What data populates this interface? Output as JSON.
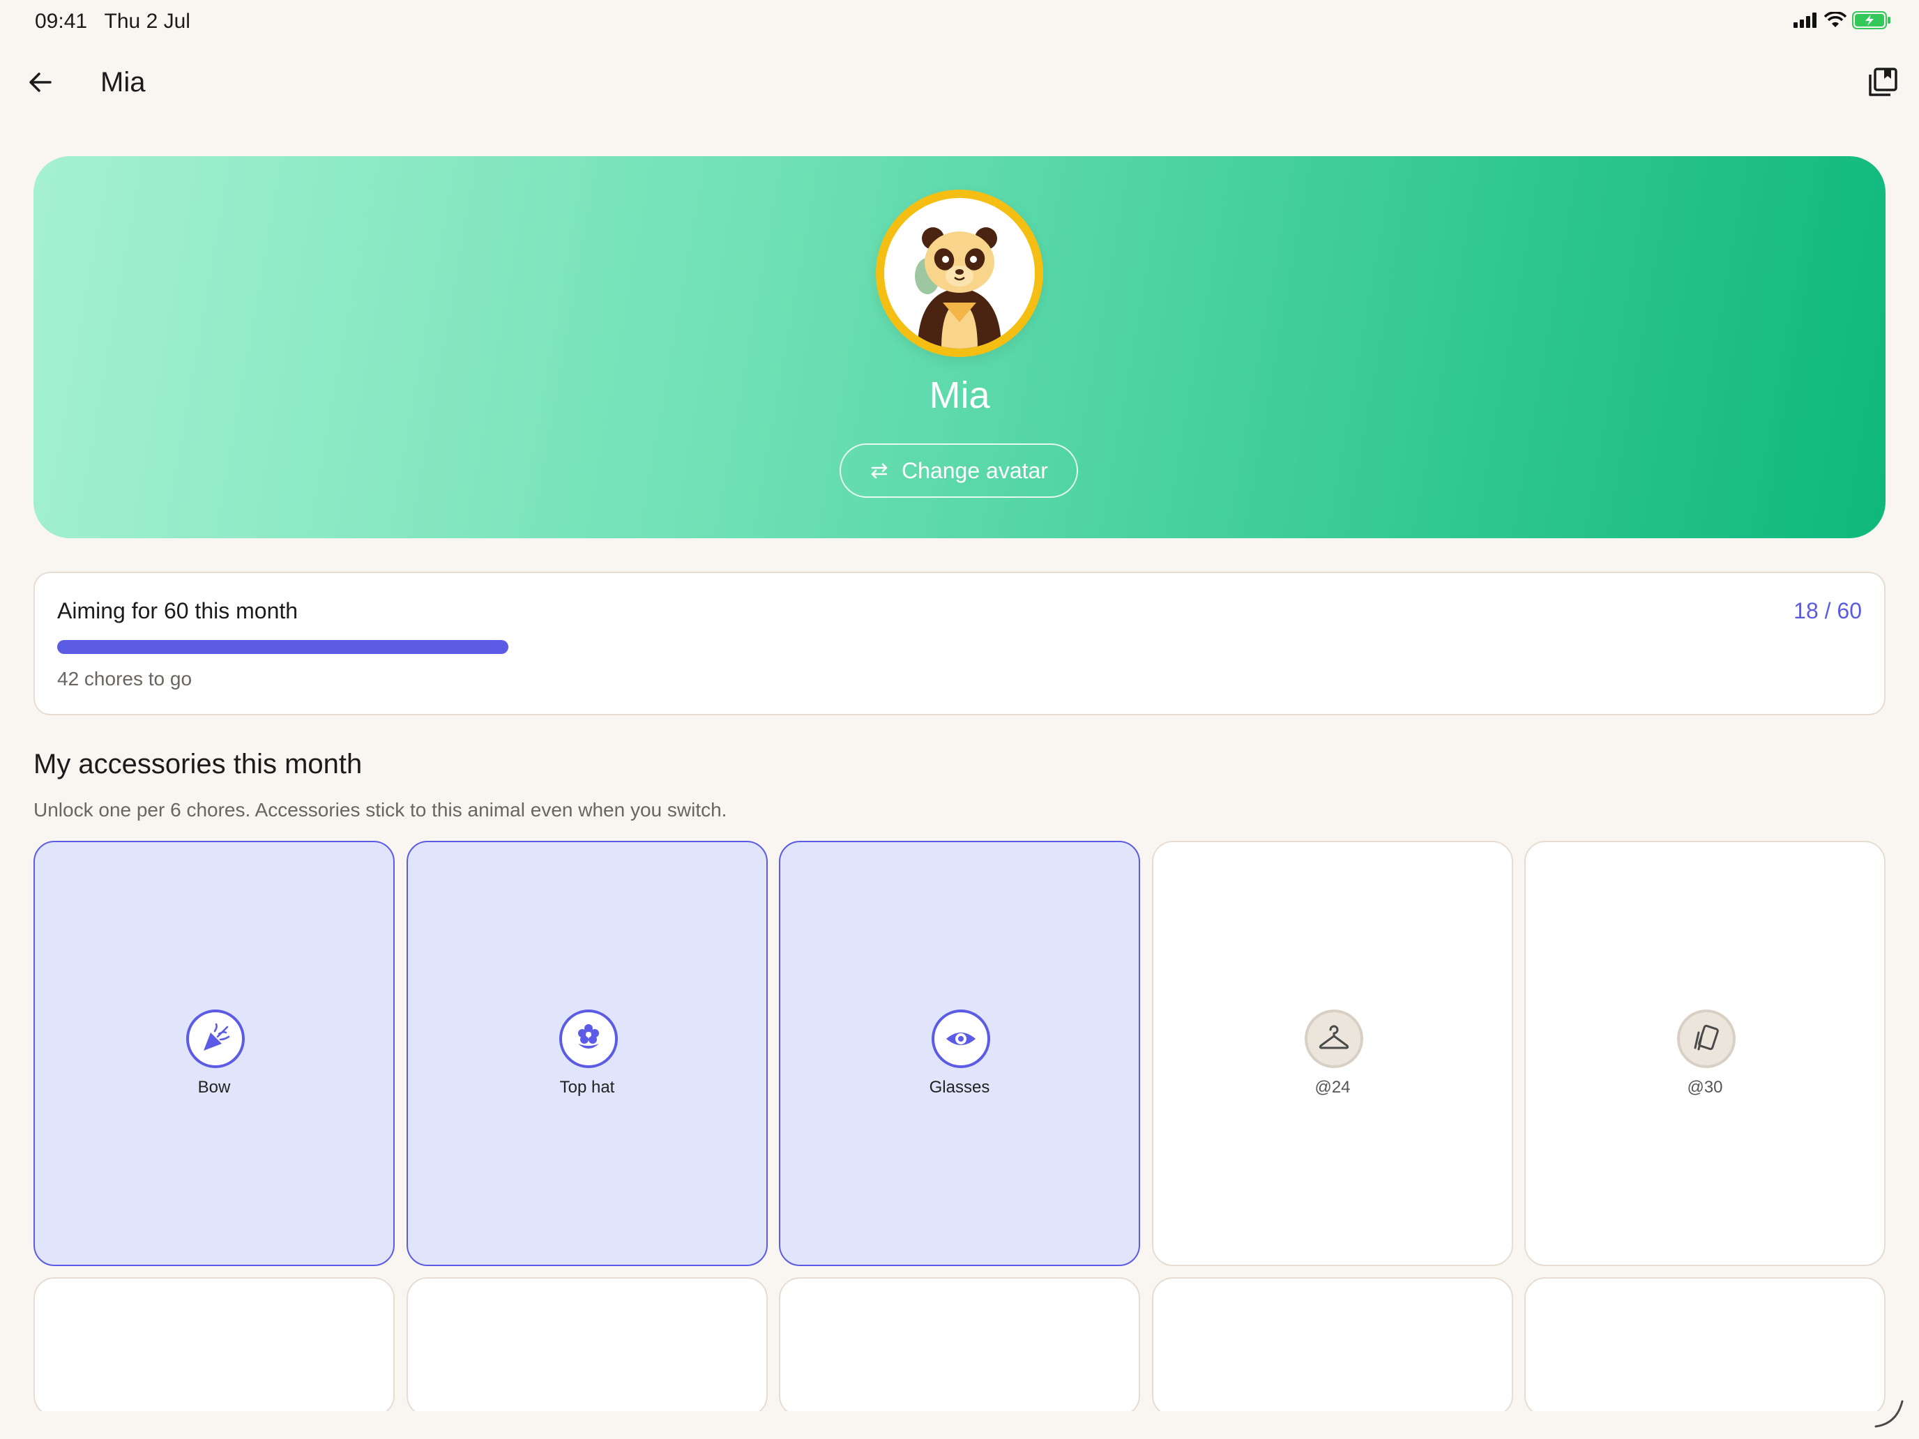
{
  "status_bar": {
    "time": "09:41",
    "date": "Thu 2 Jul"
  },
  "app_bar": {
    "title": "Mia"
  },
  "hero": {
    "name": "Mia",
    "change_avatar_label": "Change avatar",
    "avatar": "panda-avatar"
  },
  "goal": {
    "title": "Aiming for 60 this month",
    "count": "18 / 60",
    "progress": 0.25,
    "remaining": "42 chores to go",
    "bar_color": "#5b5be6"
  },
  "accessories": {
    "title": "My accessories this month",
    "subtitle": "Unlock one per 6 chores. Accessories stick to this animal even when you switch.",
    "items": [
      {
        "label": "Bow",
        "icon": "party-popper-icon",
        "unlocked": true
      },
      {
        "label": "Top hat",
        "icon": "flower-icon",
        "unlocked": true
      },
      {
        "label": "Glasses",
        "icon": "eye-icon",
        "unlocked": true
      },
      {
        "label": "@24",
        "icon": "hanger-icon",
        "unlocked": false
      },
      {
        "label": "@30",
        "icon": "cards-icon",
        "unlocked": false
      }
    ]
  },
  "colors": {
    "accent": "#5b5be6",
    "hero_start": "#a5f1d1",
    "hero_end": "#0fb87c",
    "ring": "#f4be12"
  }
}
